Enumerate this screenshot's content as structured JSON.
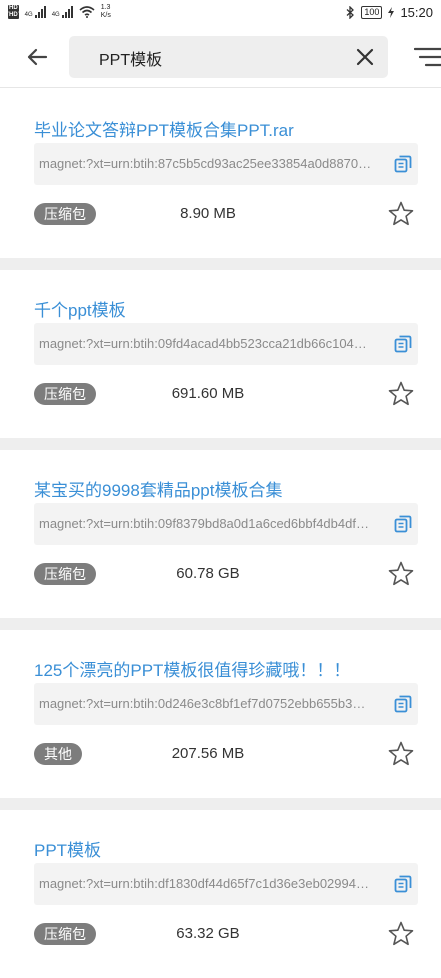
{
  "status_bar": {
    "hd_top": "HD",
    "hd_bottom": "HD",
    "sig1_label": "4G",
    "sig2_label": "4G",
    "speed_value": "1.3",
    "speed_unit": "K/s",
    "battery": "100",
    "time": "15:20"
  },
  "search": {
    "query": "PPT模板",
    "placeholder": ""
  },
  "icons": {
    "back": "arrow-back-icon",
    "clear": "close-icon",
    "filter": "filter-icon",
    "copy": "copy-icon",
    "star": "star-outline-icon"
  },
  "colors": {
    "title": "#3a8fd6",
    "tag_bg": "#7d7d7d",
    "divider": "#eeeeee",
    "magnet_bg": "#f3f3f3"
  },
  "results": [
    {
      "title": "毕业论文答辩PPT模板合集PPT.rar",
      "magnet": "magnet:?xt=urn:btih:87c5b5cd93ac25ee33854a0d8870…",
      "tag": "压缩包",
      "size": "8.90 MB"
    },
    {
      "title": "千个ppt模板",
      "magnet": "magnet:?xt=urn:btih:09fd4acad4bb523cca21db66c104…",
      "tag": "压缩包",
      "size": "691.60 MB"
    },
    {
      "title": "某宝买的9998套精品ppt模板合集",
      "magnet": "magnet:?xt=urn:btih:09f8379bd8a0d1a6ced6bbf4db4df…",
      "tag": "压缩包",
      "size": "60.78 GB"
    },
    {
      "title": "125个漂亮的PPT模板很值得珍藏哦！！！",
      "magnet": "magnet:?xt=urn:btih:0d246e3c8bf1ef7d0752ebb655b3…",
      "tag": "其他",
      "size": "207.56 MB"
    },
    {
      "title": "PPT模板",
      "magnet": "magnet:?xt=urn:btih:df1830df44d65f7c1d36e3eb02994…",
      "tag": "压缩包",
      "size": "63.32 GB"
    }
  ]
}
